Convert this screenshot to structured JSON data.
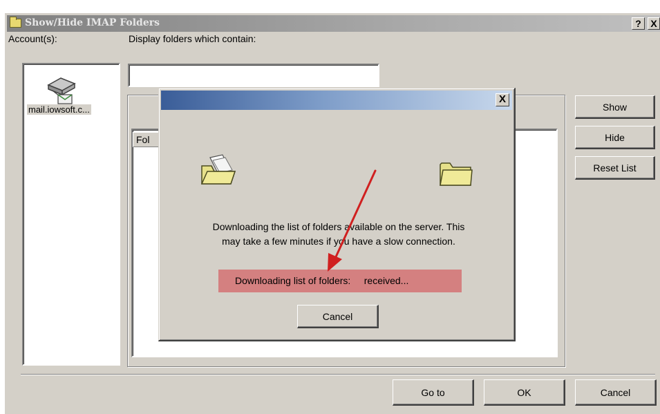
{
  "window": {
    "title": "Show/Hide IMAP Folders",
    "help_label": "?",
    "close_label": "X"
  },
  "accounts": {
    "label": "Account(s):",
    "items": [
      {
        "name": "mail.iowsoft.c..."
      }
    ]
  },
  "filter": {
    "label": "Display folders which contain:",
    "value": ""
  },
  "folder_list": {
    "column_header": "Fol"
  },
  "side_buttons": {
    "show": "Show",
    "hide": "Hide",
    "reset": "Reset List"
  },
  "bottom_buttons": {
    "goto": "Go to",
    "ok": "OK",
    "cancel": "Cancel"
  },
  "progress_dialog": {
    "close_label": "X",
    "message_line1": "Downloading the list of folders available on the server. This",
    "message_line2": "may take a few minutes if you have a slow connection.",
    "status_text": "Downloading list of folders:     received...",
    "cancel_label": "Cancel"
  },
  "colors": {
    "dialog_bg": "#d4d0c8",
    "popup_title_start": "#3a5d98",
    "status_highlight": "#d48080",
    "annotation_arrow": "#d02020"
  },
  "icons": {
    "title": "folder-icon",
    "account": "mail-server-icon",
    "popup_left": "open-folder-with-document-icon",
    "popup_right": "folder-icon"
  }
}
